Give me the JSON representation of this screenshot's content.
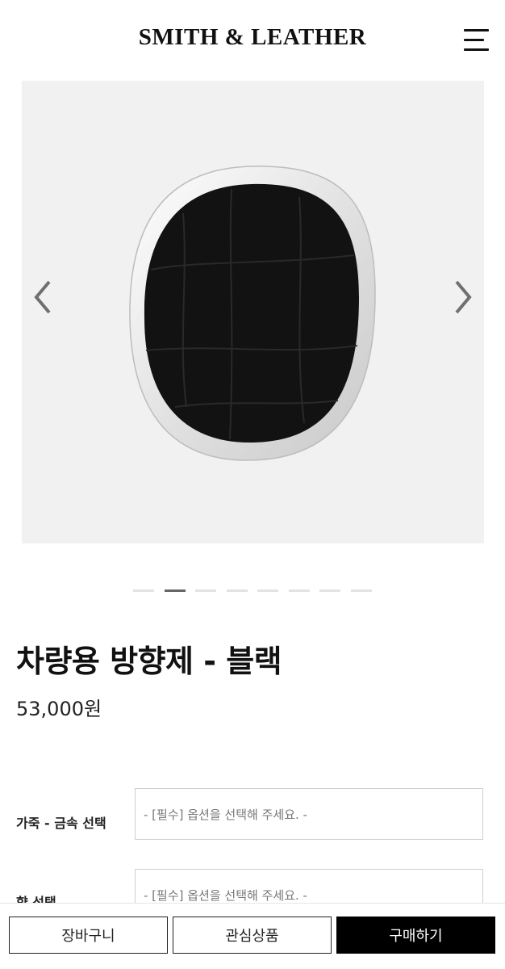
{
  "header": {
    "logo": "SMITH & LEATHER",
    "menu_icon": "hamburger-menu-icon"
  },
  "gallery": {
    "prev_icon": "chevron-left-icon",
    "next_icon": "chevron-right-icon",
    "slide_count": 8,
    "active_slide": 2
  },
  "product": {
    "title": "차량용 방향제 - 블랙",
    "price": "53,000원"
  },
  "options": [
    {
      "label": "가죽 - 금속 선택",
      "placeholder": "- [필수] 옵션을 선택해 주세요. -"
    },
    {
      "label": "향 선택",
      "placeholder": "- [필수] 옵션을 선택해 주세요. -"
    }
  ],
  "bottom_bar": {
    "cart": "장바구니",
    "wishlist": "관심상품",
    "buy": "구매하기"
  },
  "colors": {
    "buy_button": "#000000",
    "gallery_bg": "#f1f1f1",
    "active_dot": "#666666"
  }
}
